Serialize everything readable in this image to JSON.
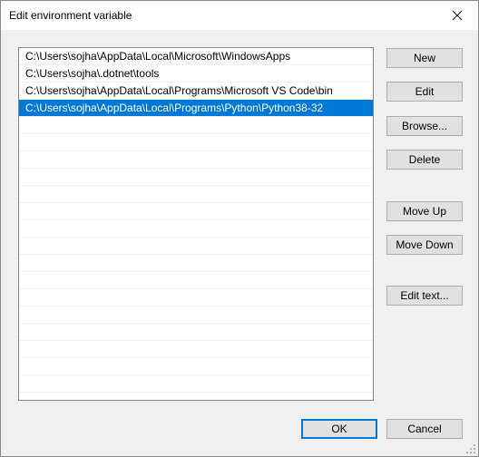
{
  "window": {
    "title": "Edit environment variable",
    "close_icon": "close-icon"
  },
  "path_list": {
    "items": [
      "C:\\Users\\sojha\\AppData\\Local\\Microsoft\\WindowsApps",
      "C:\\Users\\sojha\\.dotnet\\tools",
      "C:\\Users\\sojha\\AppData\\Local\\Programs\\Microsoft VS Code\\bin",
      "C:\\Users\\sojha\\AppData\\Local\\Programs\\Python\\Python38-32"
    ],
    "selected_index": 3
  },
  "buttons": {
    "new": "New",
    "edit": "Edit",
    "browse": "Browse...",
    "delete": "Delete",
    "move_up": "Move Up",
    "move_down": "Move Down",
    "edit_text": "Edit text...",
    "ok": "OK",
    "cancel": "Cancel"
  },
  "colors": {
    "selection": "#0078d7",
    "default_button_border": "#0078d7"
  }
}
